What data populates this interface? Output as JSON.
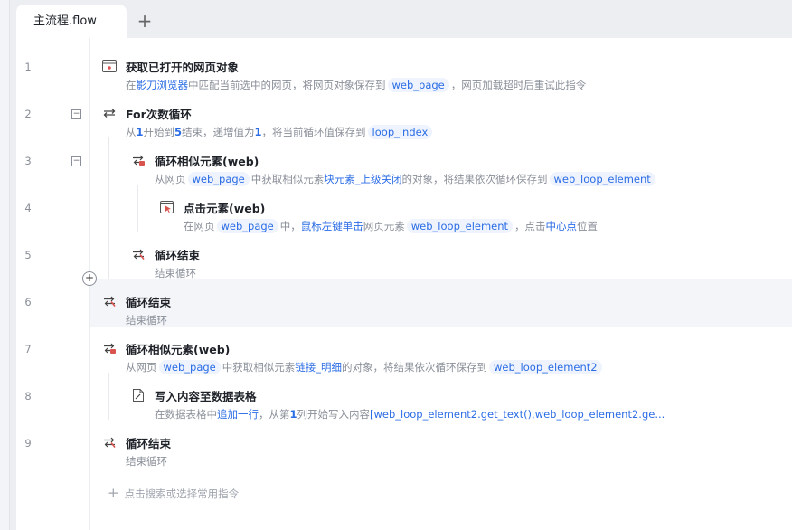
{
  "tabs": [
    {
      "label": "主流程.flow"
    }
  ],
  "tab_add": "+",
  "fold_symbol": "−",
  "insert_symbol": "+",
  "rows": [
    {
      "ln": "1",
      "icon": "browser-window-icon",
      "title": "获取已打开的网页对象",
      "desc": [
        {
          "t": "在"
        },
        {
          "t": "影刀浏览器",
          "s": "blue"
        },
        {
          "t": "中匹配当前选中的网页，将网页对象保存到"
        },
        {
          "t": "web_page",
          "s": "chip"
        },
        {
          "t": "，网页加载超时后重试此指令"
        }
      ]
    },
    {
      "ln": "2",
      "icon": "loop-icon",
      "title": "For次数循环",
      "desc": [
        {
          "t": "从"
        },
        {
          "t": "1",
          "s": "bold-blue"
        },
        {
          "t": "开始到"
        },
        {
          "t": "5",
          "s": "bold-blue"
        },
        {
          "t": "结束，递增值为"
        },
        {
          "t": "1",
          "s": "bold-blue"
        },
        {
          "t": "，将当前循环值保存到"
        },
        {
          "t": "loop_index",
          "s": "chip"
        }
      ]
    },
    {
      "ln": "3",
      "icon": "loop-element-icon",
      "title": "循环相似元素(web)",
      "desc": [
        {
          "t": "从网页"
        },
        {
          "t": "web_page",
          "s": "chip"
        },
        {
          "t": "中获取相似元素"
        },
        {
          "t": "块元素_上级关闭",
          "s": "blue"
        },
        {
          "t": "的对象，将结果依次循环保存到"
        },
        {
          "t": "web_loop_element",
          "s": "chip"
        }
      ]
    },
    {
      "ln": "4",
      "icon": "click-element-icon",
      "title": "点击元素(web)",
      "desc": [
        {
          "t": "在网页"
        },
        {
          "t": "web_page",
          "s": "chip"
        },
        {
          "t": "中，"
        },
        {
          "t": "鼠标左键单击",
          "s": "blue"
        },
        {
          "t": "网页元素"
        },
        {
          "t": "web_loop_element",
          "s": "chip"
        },
        {
          "t": "，点击"
        },
        {
          "t": "中心点",
          "s": "blue"
        },
        {
          "t": "位置"
        }
      ]
    },
    {
      "ln": "5",
      "icon": "loop-end-icon",
      "title": "循环结束",
      "desc": [
        {
          "t": "结束循环"
        }
      ]
    },
    {
      "ln": "6",
      "icon": "loop-end-icon",
      "title": "循环结束",
      "desc": [
        {
          "t": "结束循环"
        }
      ]
    },
    {
      "ln": "7",
      "icon": "loop-element-icon",
      "title": "循环相似元素(web)",
      "desc": [
        {
          "t": "从网页"
        },
        {
          "t": "web_page",
          "s": "chip"
        },
        {
          "t": "中获取相似元素"
        },
        {
          "t": "链接_明细",
          "s": "blue"
        },
        {
          "t": "的对象，将结果依次循环保存到"
        },
        {
          "t": "web_loop_element2",
          "s": "chip"
        }
      ]
    },
    {
      "ln": "8",
      "icon": "data-table-write-icon",
      "title": "写入内容至数据表格",
      "desc": [
        {
          "t": "在数据表格中"
        },
        {
          "t": "追加一行",
          "s": "blue"
        },
        {
          "t": "，从第"
        },
        {
          "t": "1",
          "s": "bold-blue"
        },
        {
          "t": "列开始写入内容"
        },
        {
          "t": "[web_loop_element2.get_text(),web_loop_element2.ge...",
          "s": "blue"
        }
      ]
    },
    {
      "ln": "9",
      "icon": "loop-end-icon",
      "title": "循环结束",
      "desc": [
        {
          "t": "结束循环"
        }
      ]
    }
  ],
  "footer_hint": "点击搜索或选择常用指令",
  "colors": {
    "accent": "#2b6de5",
    "chip_bg": "#eef3fd",
    "muted": "#8a8f99",
    "loop_icon": "#d9534f"
  }
}
